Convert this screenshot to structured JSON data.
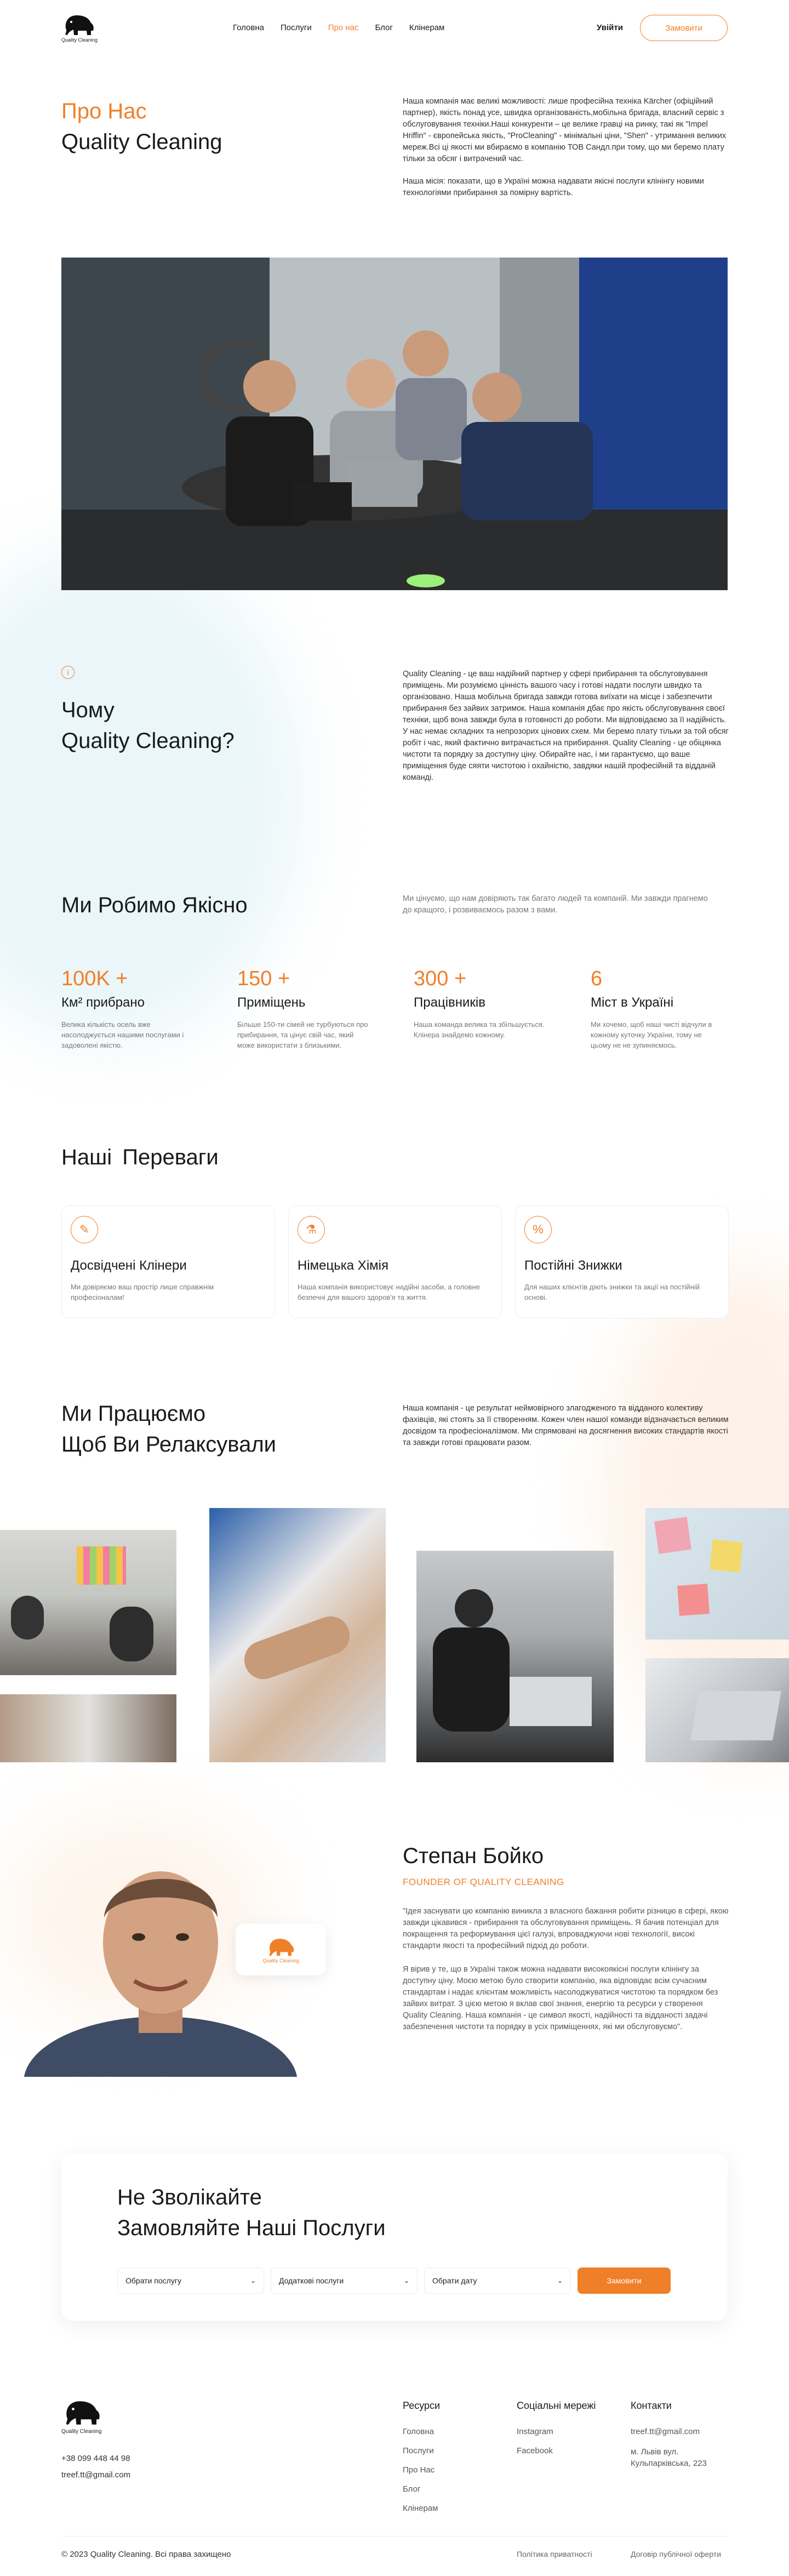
{
  "header": {
    "logo_text": "Quality Cleaning",
    "nav": [
      "Головна",
      "Послуги",
      "Про нас",
      "Блог",
      "Клінерам"
    ],
    "active_index": 2,
    "login_label": "Увійти",
    "order_label": "Замовити"
  },
  "about": {
    "title_accent": "Про Нас",
    "title": "Quality Cleaning",
    "text1": "Наша компанія має великі можливості: лише професійна техніка Kärcher (офіційний партнер), якість понад усе, швидка організованість,мобільна бригада, власний сервіс з обслуговування техніки.Наші конкуренти – це велике гравці на ринку, такі як \"Impel Hriffin\" - європейська якість, \"ProCleaning\" - мінімальні ціни, \"Shen\" - утримання великих мереж.Всі ці якості ми вбираємо в компанію ТОВ Сандл.при тому, що ми беремо плату тільки за обсяг і витрачений час.",
    "text2": "Наша місія: показати, що в Україні можна надавати якісні послуги клінінгу новими технологіями прибирання за помірну вартість."
  },
  "why": {
    "icon": "info-icon",
    "title_line1": "Чому",
    "title_line2": "Quality Cleaning?",
    "text": "Quality Cleaning - це ваш надійний партнер у сфері прибирання та обслуговування приміщень. Ми розуміємо цінність вашого часу і готові надати послуги швидко та організовано. Наша мобільна бригада завжди готова виїхати на місце і забезпечити прибирання без зайвих затримок. Наша компанія дбає про якість обслуговування своєї техніки, щоб вона завжди була в готовності до роботи. Ми відповідаємо за її надійність. У нас немає складних та непрозорих цінових схем. Ми беремо плату тільки за той обсяг робіт і час, який фактично витрачається на прибирання. Quality Cleaning - це обіцянка чистоти та порядку за доступну ціну. Обирайте нас, і ми гарантуємо, що ваше приміщення буде сяяти чистотою і охайністю, завдяки нашій професійній та відданій команді."
  },
  "quality": {
    "title": "Ми Робимо Якісно",
    "text": "Ми цінуємо, що нам довіряють так багато людей та компаній. Ми завжди прагнемо до кращого, і розвиваємось разом з вами.",
    "stats": [
      {
        "num": "100K +",
        "label": "Км² прибрано",
        "desc": "Велика кількість осель вже насолоджується нашими послугами і задоволені якістю."
      },
      {
        "num": "150 +",
        "label": "Приміщень",
        "desc": "Більше 150-ти сімей не турбуються про прибирання, та цінує свій час, який може використати з близькими."
      },
      {
        "num": "300 +",
        "label": "Працівників",
        "desc": "Наша команда велика та збільшується. Клінера знайдемо кожному."
      },
      {
        "num": "6",
        "label": "Міст в Україні",
        "desc": "Ми хочемо, щоб наші чисті відчули в кожному куточку України, тому не цьому не не зупиняємось."
      }
    ]
  },
  "advantages": {
    "title": "Наші Переваги",
    "cards": [
      {
        "icon": "cleaner-icon",
        "title": "Досвідчені Клінери",
        "desc": "Ми довіряємо ваш простір лише справжнім професіоналам!"
      },
      {
        "icon": "chemistry-icon",
        "title": "Німецька Хімія",
        "desc": "Наша компанія використовує надійні засоби, а головне безпечні для вашого здоров'я та життя."
      },
      {
        "icon": "discount-icon",
        "title": "Постійні Знижки",
        "desc": "Для наших клієнтів діють знижки та акції на постійній основі."
      }
    ]
  },
  "relax": {
    "title_line1": "Ми Працюємо",
    "title_line2": "Щоб Ви Релаксували",
    "text": "Наша компанія - це результат неймовірного злагодженого та відданого колективу фахівців, які стоять за її створенням. Кожен член нашої команди відзначається великим досвідом та професіоналізмом. Ми спрямовані на досягнення високих стандартів якості та завжди готові працювати разом."
  },
  "founder": {
    "name": "Степан Бойко",
    "role": "FOUNDER OF QUALITY CLEANING",
    "quote1": "\"Ідея заснувати цю компанію виникла з власного бажання робити різницю в сфері, якою завжди цікавився - прибирання та обслуговування приміщень. Я бачив потенціал для покращення та реформування цієї галузі, впроваджуючи нові технології, високі стандарти якості та професійний підхід до роботи.",
    "quote2": "Я вірив у те, що в Україні також можна надавати високоякісні послуги клінінгу за доступну ціну. Моєю метою було створити компанію, яка відповідає всім сучасним стандартам і надає клієнтам можливість насолоджуватися чистотою та порядком без зайвих витрат. З цією метою я вклав свої знання, енергію та ресурси у створення Quality Cleaning. Наша компанія - це символ якості, надійності та відданості задачі забезпечення чистоти та порядку в усіх приміщеннях, які ми обслуговуємо\".",
    "badge_text": "Quality Cleaning"
  },
  "order_form": {
    "title_line1": "Не Зволікайте",
    "title_line2": "Замовляйте Наші Послуги",
    "fields": [
      "Обрати послугу",
      "Додаткові послуги",
      "Обрати дату"
    ],
    "submit": "Замовити"
  },
  "footer": {
    "logo_text": "Quality Cleaning",
    "phone": "+38 099 448 44 98",
    "email": "treef.tt@gmail.com",
    "cols": [
      {
        "title": "Ресурси",
        "items": [
          "Головна",
          "Послуги",
          "Про Нас",
          "Блог",
          "Клінерам"
        ]
      },
      {
        "title": "Соціальні мережі",
        "items": [
          "Instagram",
          "Facebook"
        ]
      },
      {
        "title": "Контакти",
        "items": [
          "treef.tt@gmail.com",
          "м. Львів вул. Кульпарківська, 223"
        ]
      }
    ],
    "copyright": "© 2023 Quality Cleaning. Всі права захищено",
    "privacy": "Політика приватності",
    "offer": "Договір публічної оферти"
  },
  "colors": {
    "accent": "#f07f2a",
    "text": "#1a1a1a",
    "muted": "#777777"
  }
}
